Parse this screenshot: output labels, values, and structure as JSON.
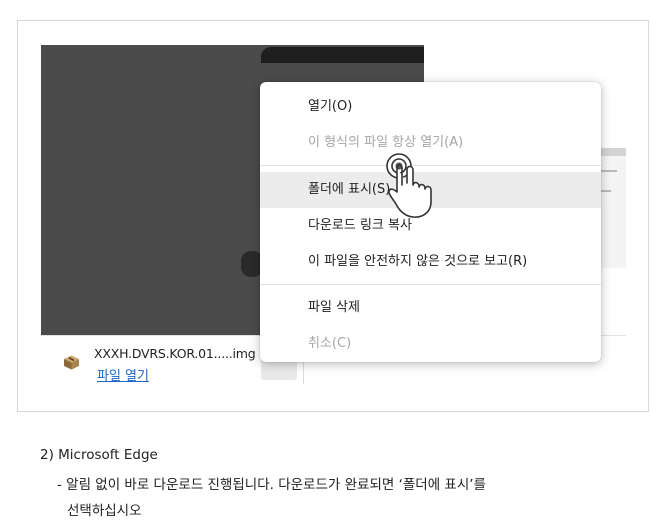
{
  "download_item": {
    "file_name": "XXXH.DVRS.KOR.01.....img",
    "open_link": "파일 열기",
    "more_button": "···"
  },
  "context_menu": {
    "items": [
      {
        "label": "열기(O)",
        "disabled": false
      },
      {
        "label": "이 형식의 파일 항상 열기(A)",
        "disabled": true
      },
      {
        "label": "폴더에 표시(S)",
        "disabled": false,
        "highlighted": true
      },
      {
        "label": "다운로드 링크 복사",
        "disabled": false
      },
      {
        "label": "이 파일을 안전하지 않은 것으로 보고(R)",
        "disabled": false
      },
      {
        "label": "파일 삭제",
        "disabled": false
      },
      {
        "label": "취소(C)",
        "disabled": true
      }
    ]
  },
  "caption": {
    "heading": "2) Microsoft Edge",
    "line1": "- 알림 없이 바로 다운로드 진행됩니다. 다운로드가 완료되면 ‘폴더에 표시’를",
    "line2": "선택하십시오"
  },
  "colors": {
    "link": "#1a66c2",
    "disabled_text": "#a6a6a6",
    "highlight_row": "#ececec",
    "preview_dark": "#4b4b4b"
  }
}
